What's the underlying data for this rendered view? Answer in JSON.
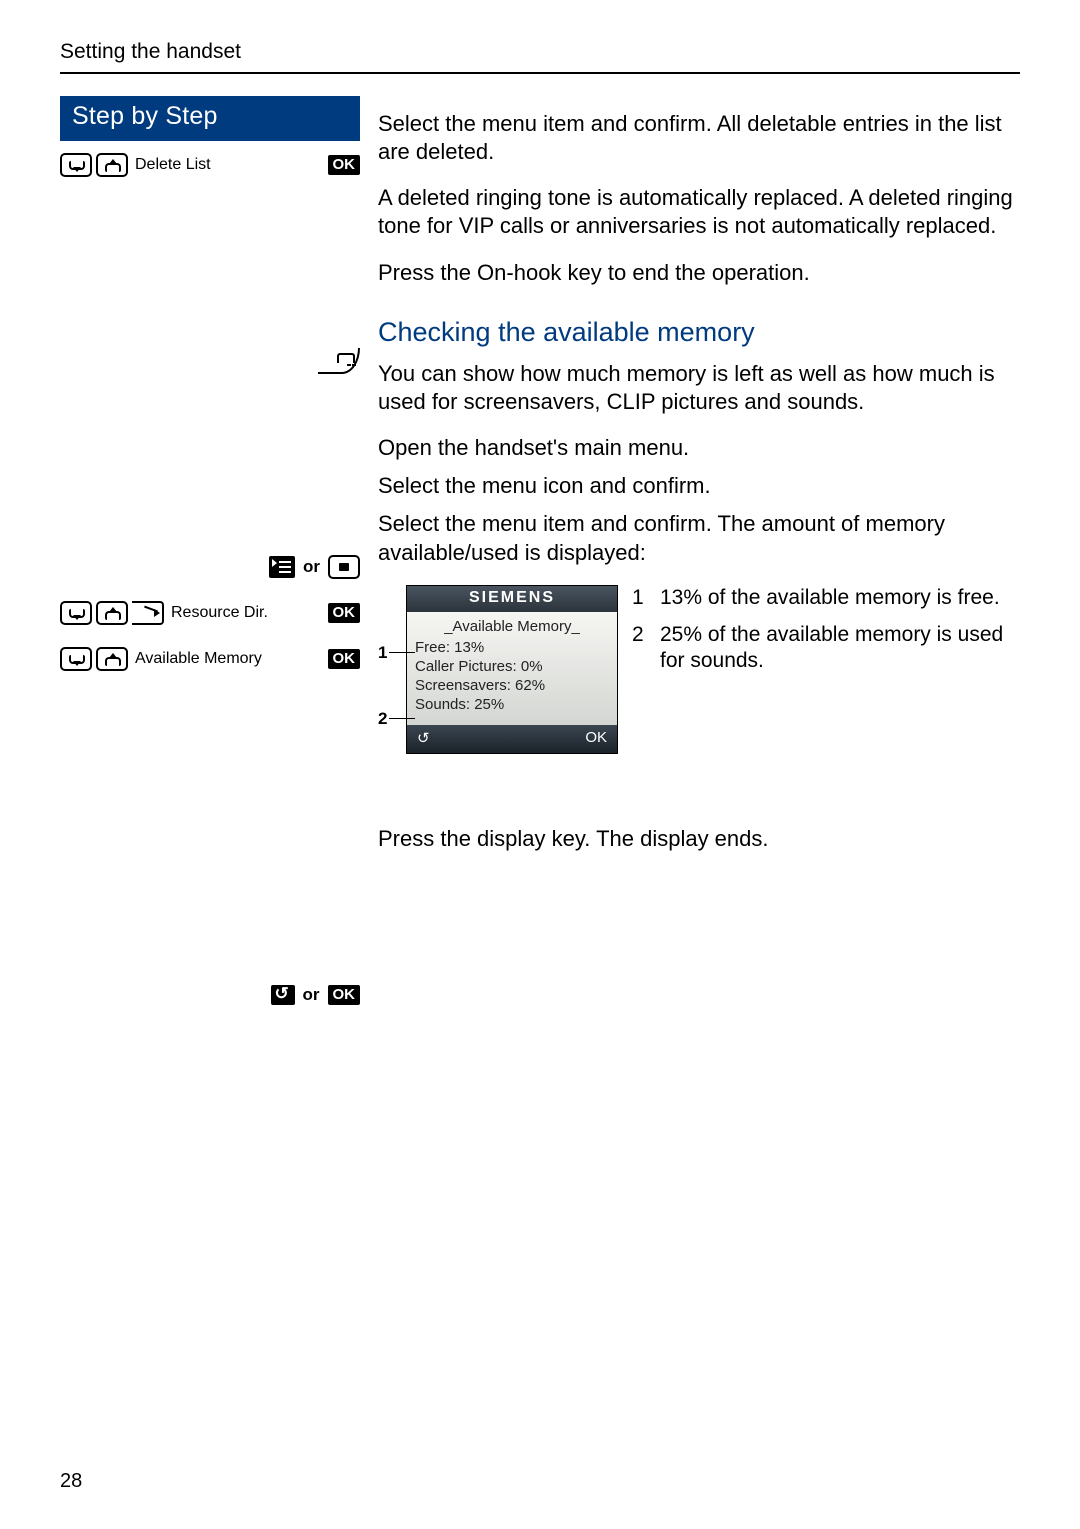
{
  "header": {
    "running": "Setting the handset"
  },
  "sidebar": {
    "title": "Step by Step",
    "deleteList": {
      "label": "Delete List",
      "ok": "OK"
    },
    "menuOr": {
      "or": "or"
    },
    "resourceDir": {
      "label": "Resource Dir.",
      "ok": "OK"
    },
    "availableMemory": {
      "label": "Available Memory",
      "ok": "OK"
    },
    "backOrOk": {
      "or": "or",
      "ok": "OK"
    }
  },
  "body": {
    "p1": "Select the menu item and confirm. All deletable entries in the list are deleted.",
    "p2": "A deleted ringing tone is automatically replaced. A deleted ringing tone for VIP calls or anniversaries is not automatically replaced.",
    "p3": "Press the On-hook key to end the operation.",
    "h2": "Checking the available memory",
    "p4": "You can show how much memory is left as well as how much is used for screensavers, CLIP pictures and sounds.",
    "p5": "Open the handset's main menu.",
    "p6": "Select the menu icon and confirm.",
    "p7": "Select the menu item and confirm. The amount of memory available/used is displayed:",
    "p8": "Press the display key. The display ends."
  },
  "phone": {
    "brand": "SIEMENS",
    "title": "_Available Memory_",
    "lines": {
      "free": "Free: 13%",
      "callerPictures": "Caller Pictures: 0%",
      "screensavers": "Screensavers: 62%",
      "sounds": "Sounds: 25%"
    },
    "footer": {
      "back": "↺",
      "ok": "OK"
    },
    "leaders": {
      "one": "1",
      "two": "2"
    }
  },
  "legend": {
    "items": [
      {
        "num": "1",
        "text": "13% of the available memory is free."
      },
      {
        "num": "2",
        "text": "25% of the available memory is used for sounds."
      }
    ]
  },
  "pageNumber": "28"
}
